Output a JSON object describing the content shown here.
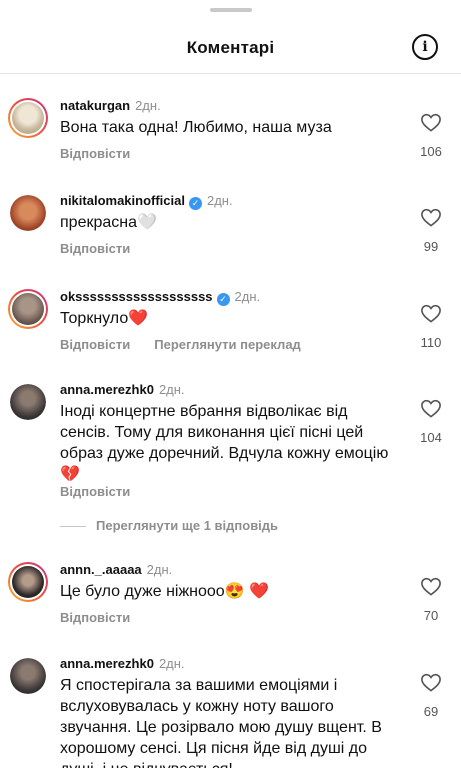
{
  "header": {
    "title": "Коментарі",
    "info_icon": "info-icon"
  },
  "comments": [
    {
      "username": "natakurgan",
      "verified": false,
      "time": "2дн.",
      "text": "Вона така одна! Любимо, наша муза",
      "reply": "Відповісти",
      "translate": "",
      "likes": "106",
      "story": true,
      "avatar_color": "#d9c9b0"
    },
    {
      "username": "nikitalomakinofficial",
      "verified": true,
      "time": "2дн.",
      "text": "прекрасна",
      "emoji": "🤍",
      "reply": "Відповісти",
      "translate": "",
      "likes": "99",
      "story": false,
      "avatar_color": "#b85c38"
    },
    {
      "username": "oksssssssssssssssssss",
      "verified": true,
      "time": "2дн.",
      "text": "Торкнуло",
      "emoji": "❤️",
      "reply": "Відповісти",
      "translate": "Переглянути переклад",
      "likes": "110",
      "story": true,
      "avatar_color": "#6b5a52"
    },
    {
      "username": "anna.merezhk0",
      "verified": false,
      "time": "2дн.",
      "text": "Іноді концертне вбрання відволікає від сенсів. Тому для виконання цієї пісні цей образ дуже доречний. Вдчула кожну емоцію",
      "emoji": "💔",
      "reply": "Відповісти",
      "translate": "",
      "likes": "104",
      "story": false,
      "avatar_color": "#3a3535"
    },
    {
      "username": "annn._.aaaaa",
      "verified": false,
      "time": "2дн.",
      "text": "Це було дуже ніжнооо",
      "emoji": "😍 ❤️",
      "reply": "Відповісти",
      "translate": "",
      "likes": "70",
      "story": true,
      "avatar_color": "#2e2a2a"
    },
    {
      "username": "anna.merezhk0",
      "verified": false,
      "time": "2дн.",
      "text": "Я спостерігала за вашими емоціями і вслуховувалась у кожну ноту вашого звучання. Це розірвало мою душу вщент. В хорошому сенсі. Ця пісня йде від душі до душі, і це відчувається!",
      "reply": "",
      "translate": "",
      "likes": "69",
      "story": false,
      "avatar_color": "#3a3535"
    }
  ],
  "view_replies": "Переглянути ще 1 відповідь"
}
